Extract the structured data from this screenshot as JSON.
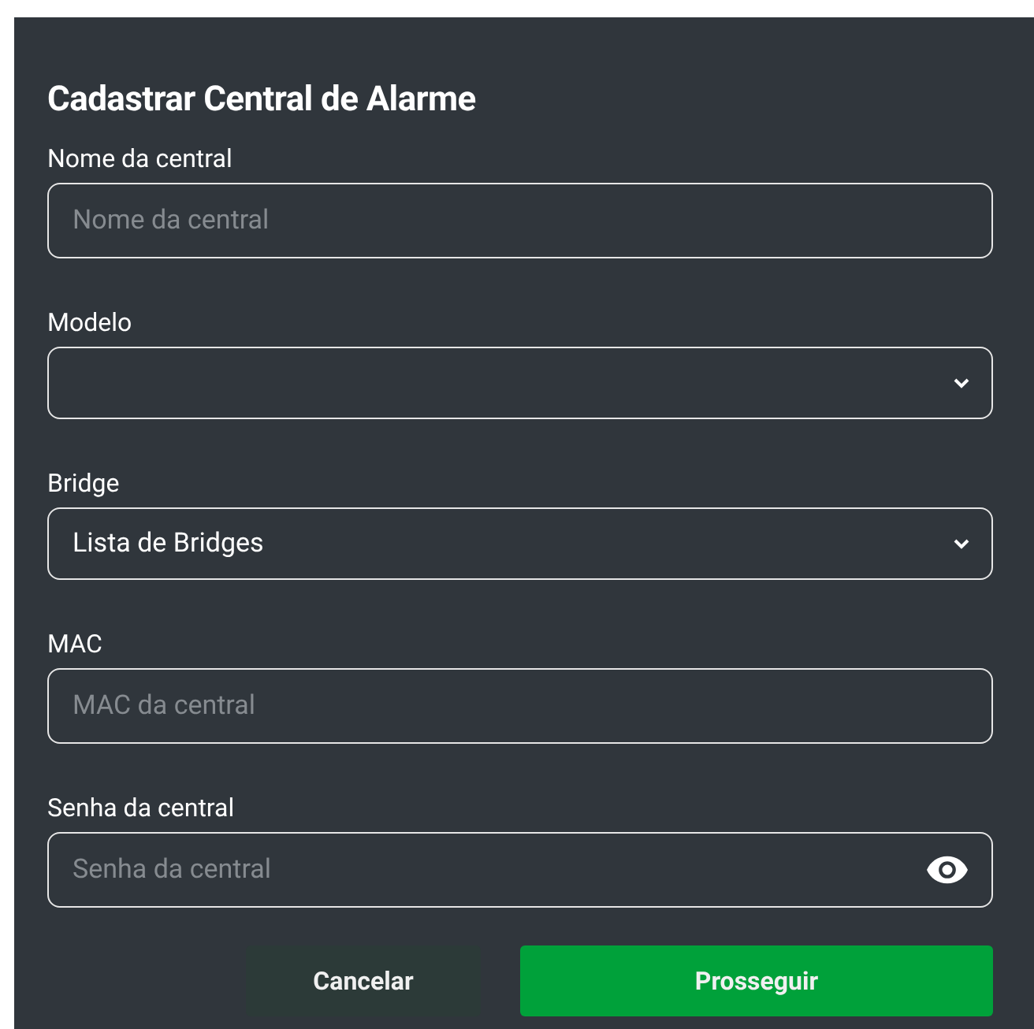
{
  "dialog": {
    "title": "Cadastrar Central de Alarme",
    "fields": [
      {
        "label": "Nome da central",
        "kind": "text",
        "placeholder": "Nome da central"
      },
      {
        "label": "Modelo",
        "kind": "select"
      },
      {
        "label": "Bridge",
        "kind": "select",
        "value": "Lista de Bridges"
      },
      {
        "label": "MAC",
        "kind": "text",
        "placeholder": "MAC da central"
      },
      {
        "label": "Senha da central",
        "kind": "password",
        "placeholder": "Senha da central"
      }
    ],
    "buttons": [
      {
        "label": "Cancelar",
        "kind": "secondary"
      },
      {
        "label": "Prosseguir",
        "kind": "primary"
      }
    ]
  }
}
